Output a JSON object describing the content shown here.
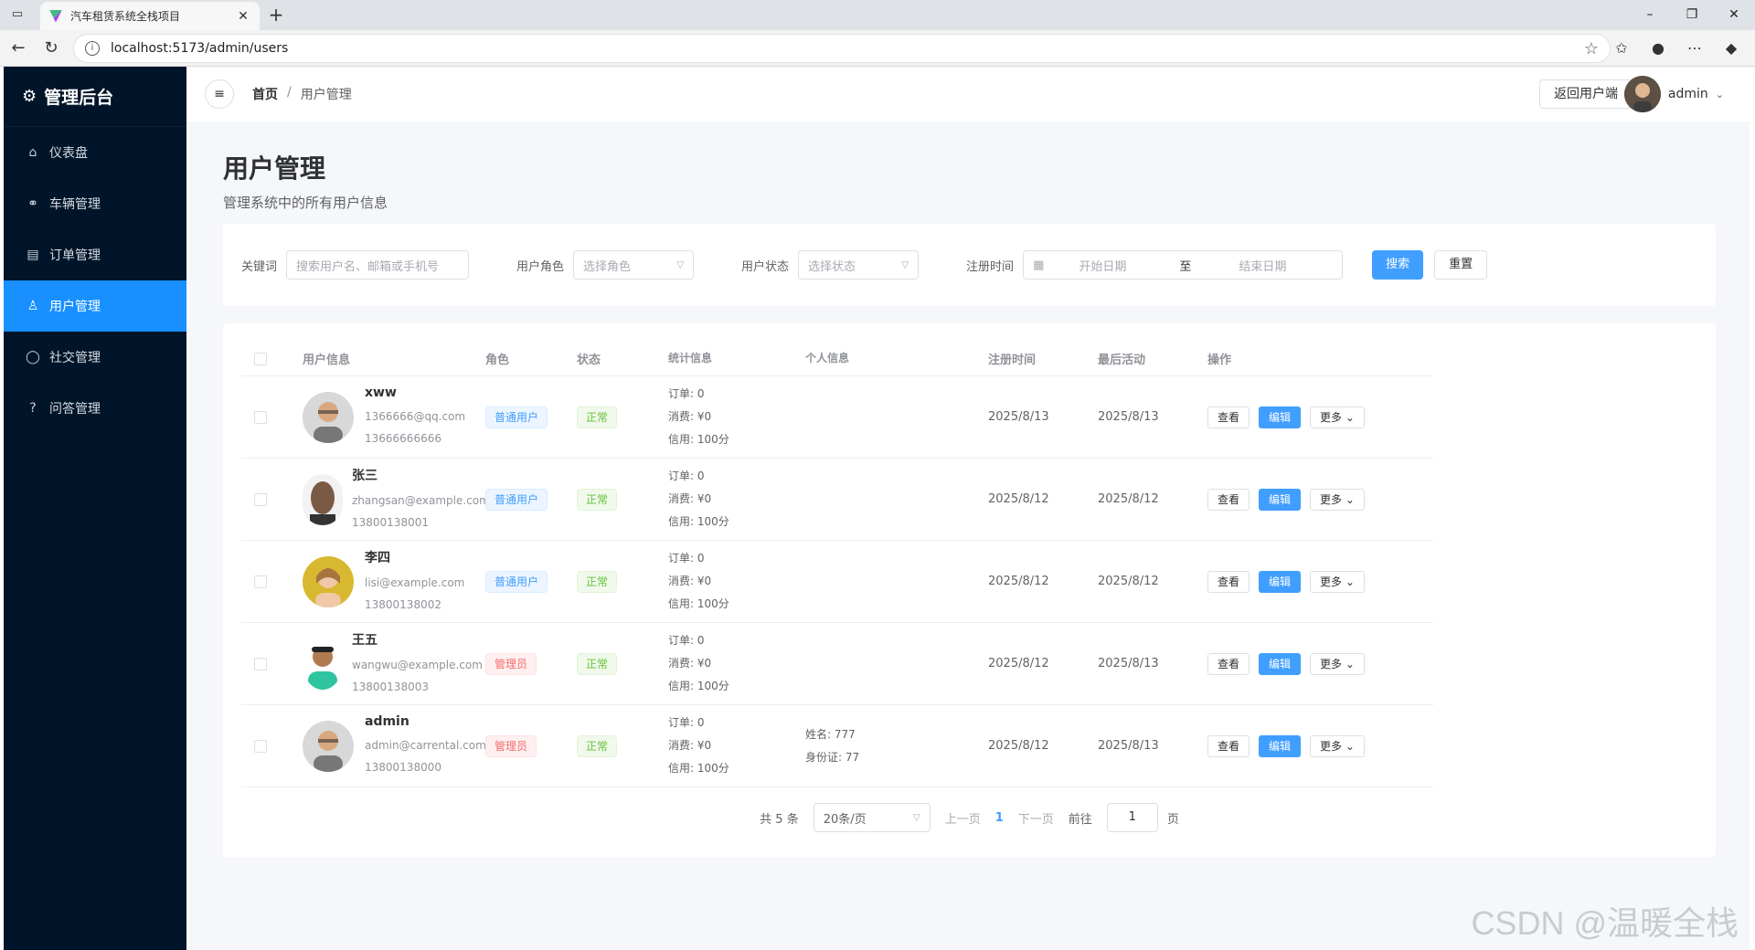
{
  "browser": {
    "tab_title": "汽车租赁系统全栈项目",
    "url": "localhost:5173/admin/users"
  },
  "sidebar": {
    "title": "管理后台",
    "items": [
      {
        "label": "仪表盘",
        "icon": "dashboard-icon"
      },
      {
        "label": "车辆管理",
        "icon": "bike-icon"
      },
      {
        "label": "订单管理",
        "icon": "document-icon"
      },
      {
        "label": "用户管理",
        "icon": "user-icon",
        "active": true
      },
      {
        "label": "社交管理",
        "icon": "chat-icon"
      },
      {
        "label": "问答管理",
        "icon": "question-icon"
      }
    ]
  },
  "header": {
    "breadcrumb": {
      "home": "首页",
      "sep": "/",
      "current": "用户管理"
    },
    "back_button": "返回用户端",
    "username": "admin"
  },
  "page": {
    "title": "用户管理",
    "subtitle": "管理系统中的所有用户信息"
  },
  "filters": {
    "keyword_label": "关键词",
    "keyword_placeholder": "搜索用户名、邮箱或手机号",
    "role_label": "用户角色",
    "role_placeholder": "选择角色",
    "status_label": "用户状态",
    "status_placeholder": "选择状态",
    "date_label": "注册时间",
    "date_start": "开始日期",
    "date_to": "至",
    "date_end": "结束日期",
    "search_button": "搜索",
    "reset_button": "重置"
  },
  "table": {
    "columns": [
      "用户信息",
      "角色",
      "状态",
      "统计信息",
      "个人信息",
      "注册时间",
      "最后活动",
      "操作"
    ],
    "actions": {
      "view": "查看",
      "edit": "编辑",
      "more": "更多"
    },
    "rows": [
      {
        "name": "xww",
        "email": "1366666@qq.com",
        "phone": "13666666666",
        "role": "普通用户",
        "role_type": "user",
        "status": "正常",
        "orders": "订单: 0",
        "spend": "消费: ¥0",
        "credit": "信用: 100分",
        "info1": "",
        "info2": "",
        "registered": "2025/8/13",
        "last_active": "2025/8/13"
      },
      {
        "name": "张三",
        "email": "zhangsan@example.com",
        "phone": "13800138001",
        "role": "普通用户",
        "role_type": "user",
        "status": "正常",
        "orders": "订单: 0",
        "spend": "消费: ¥0",
        "credit": "信用: 100分",
        "info1": "",
        "info2": "",
        "registered": "2025/8/12",
        "last_active": "2025/8/12"
      },
      {
        "name": "李四",
        "email": "lisi@example.com",
        "phone": "13800138002",
        "role": "普通用户",
        "role_type": "user",
        "status": "正常",
        "orders": "订单: 0",
        "spend": "消费: ¥0",
        "credit": "信用: 100分",
        "info1": "",
        "info2": "",
        "registered": "2025/8/12",
        "last_active": "2025/8/12"
      },
      {
        "name": "王五",
        "email": "wangwu@example.com",
        "phone": "13800138003",
        "role": "管理员",
        "role_type": "admin",
        "status": "正常",
        "orders": "订单: 0",
        "spend": "消费: ¥0",
        "credit": "信用: 100分",
        "info1": "",
        "info2": "",
        "registered": "2025/8/12",
        "last_active": "2025/8/13"
      },
      {
        "name": "admin",
        "email": "admin@carrental.com",
        "phone": "13800138000",
        "role": "管理员",
        "role_type": "admin",
        "status": "正常",
        "orders": "订单: 0",
        "spend": "消费: ¥0",
        "credit": "信用: 100分",
        "info1": "姓名: 777",
        "info2": "身份证: 77",
        "registered": "2025/8/12",
        "last_active": "2025/8/13"
      }
    ]
  },
  "pagination": {
    "total": "共 5 条",
    "page_size": "20条/页",
    "prev": "上一页",
    "current": "1",
    "next": "下一页",
    "goto_label": "前往",
    "goto_value": "1",
    "page_suffix": "页"
  },
  "watermark": "CSDN @温暖全栈"
}
